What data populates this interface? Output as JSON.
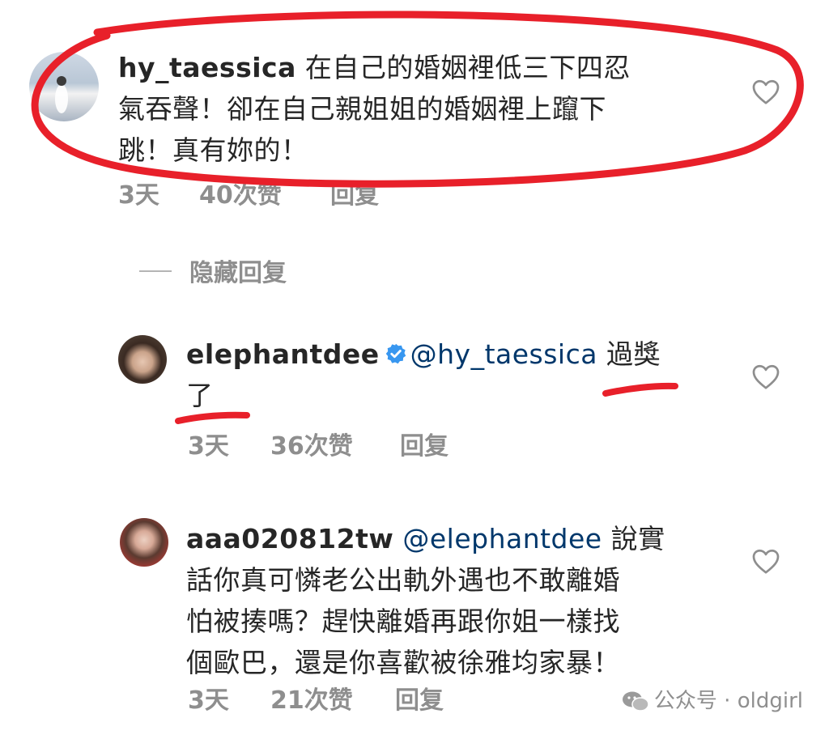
{
  "comments": [
    {
      "username": "hy_taessica",
      "text": "在自己的婚姻裡低三下四忍氣吞聲！卻在自己親姐姐的婚姻裡上躥下跳！真有妳的！",
      "line1": " 在自己的婚姻裡低三下四忍",
      "line2": "氣吞聲！卻在自己親姐姐的婚姻裡上躥下",
      "line3": "跳！真有妳的！",
      "time": "3天",
      "likes": "40次赞",
      "reply": "回复"
    },
    {
      "username": "elephantdee",
      "verified": true,
      "mention": "@hy_taessica",
      "text_a": " 過獎",
      "text_b": "了",
      "time": "3天",
      "likes": "36次赞",
      "reply": "回复"
    },
    {
      "username": "aaa020812tw",
      "mention": "@elephantdee",
      "line1_tail": " 說實",
      "line2": "話你真可憐老公出軌外遇也不敢離婚",
      "line3": "怕被揍嗎？趕快離婚再跟你姐一樣找",
      "line4": "個歐巴，還是你喜歡被徐雅均家暴！",
      "time": "3天",
      "likes": "21次赞",
      "reply": "回复"
    }
  ],
  "hidden_replies_label": "隐藏回复",
  "watermark": {
    "text": "公众号 · oldgirl",
    "icon": "wechat-icon"
  },
  "colors": {
    "annotation_red": "#e8202a",
    "meta_gray": "#8e8e8e",
    "verified_blue": "#3897f0",
    "mention_blue": "#00376b"
  },
  "icons": [
    "heart-icon",
    "verified-badge-icon",
    "wechat-icon"
  ]
}
